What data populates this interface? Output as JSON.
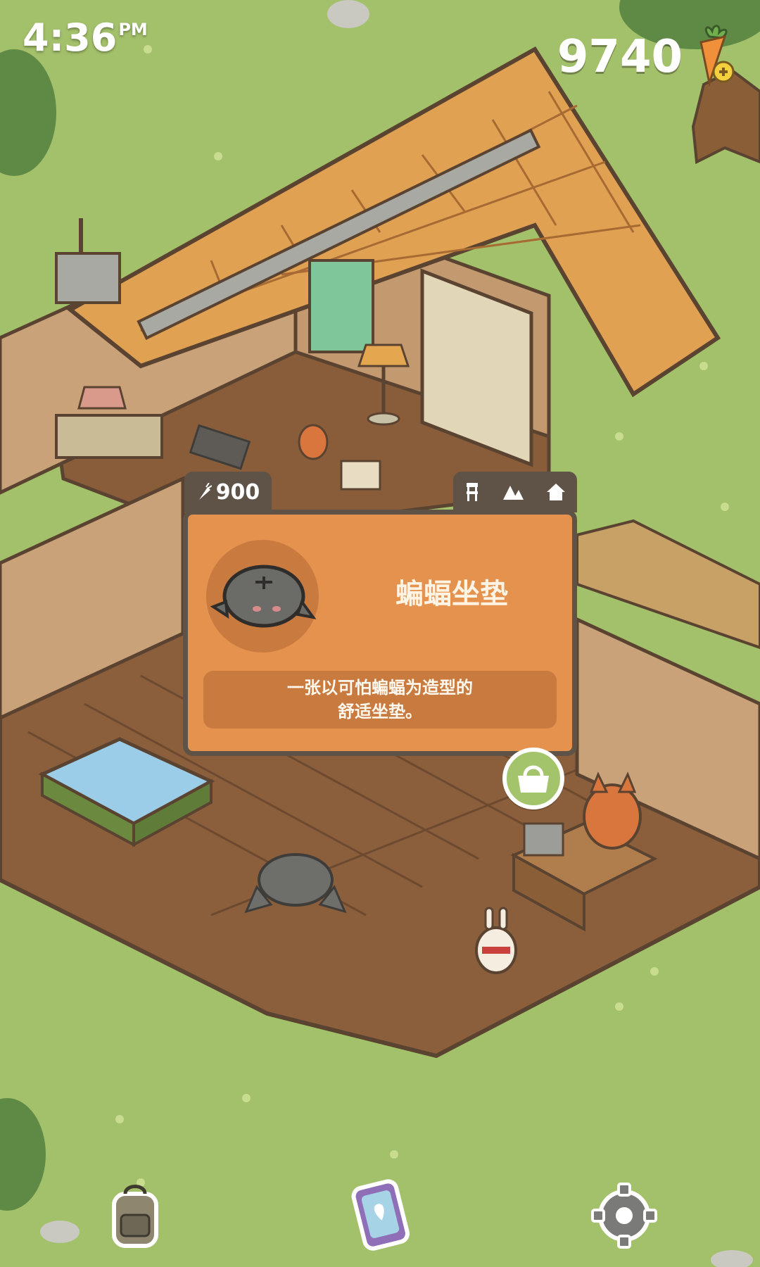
{
  "status_bar": {
    "time": "4:36",
    "ampm": "PM"
  },
  "currency": {
    "amount": "9740",
    "icon": "carrot-icon",
    "add_icon": "plus-icon"
  },
  "item_card": {
    "price": "900",
    "price_icon": "carrot-icon",
    "category_icons": [
      "chair-icon",
      "mountain-icon",
      "house-icon"
    ],
    "name": "蝙蝠坐垫",
    "description_line1": "一张以可怕蝙蝠为造型的",
    "description_line2": "舒适坐垫。",
    "item_icon": "bat-cushion-icon"
  },
  "buy_button": {
    "icon": "shopping-bag-icon"
  },
  "bottom_bar": {
    "left_icon": "backpack-icon",
    "center_icon": "phone-map-icon",
    "right_icon": "gear-icon"
  },
  "colors": {
    "card_bg": "#e6924f",
    "card_border": "#5e5346",
    "grass": "#9dbb64",
    "buy_button": "#a3c46b"
  }
}
